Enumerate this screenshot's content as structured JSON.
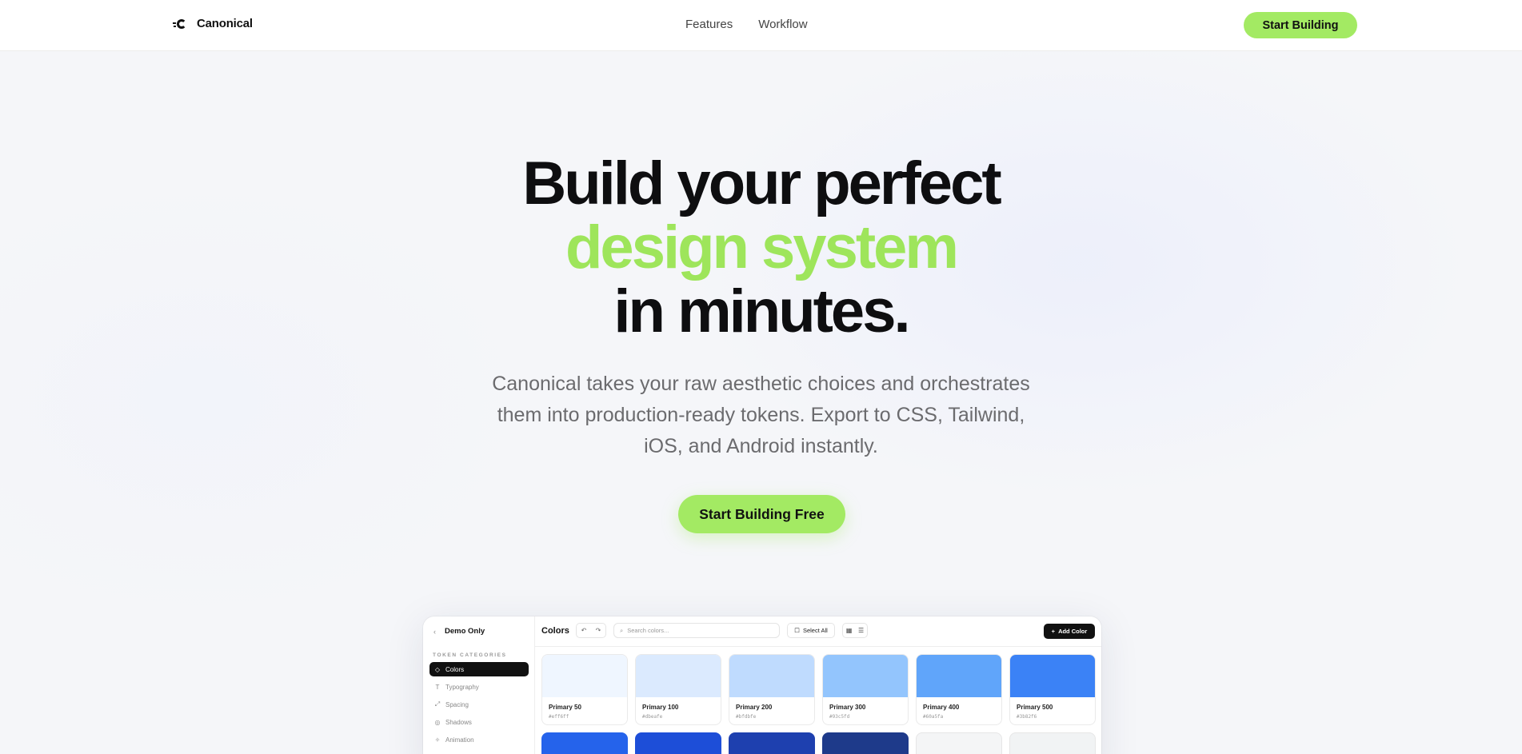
{
  "nav": {
    "brand": "Canonical",
    "links": [
      "Features",
      "Workflow"
    ],
    "cta": "Start Building"
  },
  "hero": {
    "title_line1": "Build your perfect",
    "title_accent": "design system",
    "title_line3": "in minutes.",
    "subtitle": "Canonical takes your raw aesthetic choices and orchestrates them into production-ready tokens. Export to CSS, Tailwind, iOS, and Android instantly.",
    "cta": "Start Building Free"
  },
  "preview": {
    "back_label": "Demo Only",
    "section_label": "TOKEN CATEGORIES",
    "categories": [
      {
        "label": "Colors",
        "icon": "palette-icon",
        "glyph": "◇"
      },
      {
        "label": "Typography",
        "icon": "type-icon",
        "glyph": "T"
      },
      {
        "label": "Spacing",
        "icon": "spacing-icon",
        "glyph": "⤢"
      },
      {
        "label": "Shadows",
        "icon": "layers-icon",
        "glyph": "◎"
      },
      {
        "label": "Animation",
        "icon": "sparkle-icon",
        "glyph": "✧"
      }
    ],
    "title": "Colors",
    "search_placeholder": "Search colors...",
    "select_all": "Select All",
    "add_color": "Add Color",
    "swatches": [
      {
        "name": "Primary 50",
        "hex": "#eff6ff",
        "color": "#eff6ff"
      },
      {
        "name": "Primary 100",
        "hex": "#dbeafe",
        "color": "#dbeafe"
      },
      {
        "name": "Primary 200",
        "hex": "#bfdbfe",
        "color": "#bfdbfe"
      },
      {
        "name": "Primary 300",
        "hex": "#93c5fd",
        "color": "#93c5fd"
      },
      {
        "name": "Primary 400",
        "hex": "#60a5fa",
        "color": "#60a5fa"
      },
      {
        "name": "Primary 500",
        "hex": "#3b82f6",
        "color": "#3b82f6"
      }
    ],
    "row2_colors": [
      "#2563eb",
      "#1d4ed8",
      "#1e40af",
      "#1e3a8a",
      "#f4f5f6",
      "#f1f3f4"
    ]
  },
  "colors": {
    "accent": "#a3ea63",
    "accent_text": "#9ee55b",
    "dark": "#111111"
  }
}
